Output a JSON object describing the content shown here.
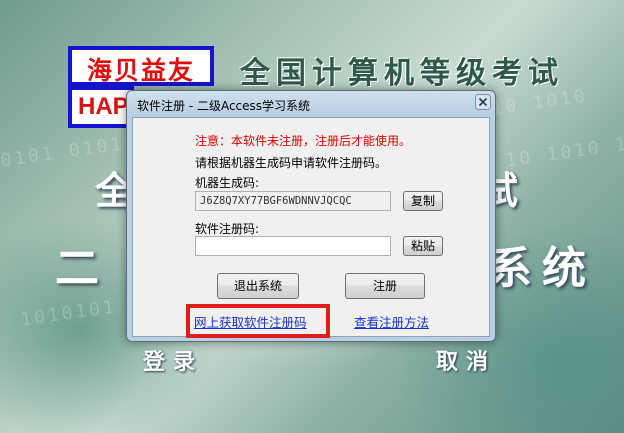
{
  "background": {
    "logo_text": "海贝益友",
    "logo_sub_text": "HAPP",
    "banner": "全国计算机等级考试",
    "big_left": "二",
    "big_left_top": "全",
    "big_right": "系统",
    "big_right_top": "试",
    "login_label": "登录",
    "cancel_label": "取消",
    "binary_rows": [
      "01010 1010",
      "10 1010 101",
      "0101 0101 0",
      "1010101 01"
    ]
  },
  "dialog": {
    "title": "软件注册 - 二级Access学习系统",
    "warning": "注意：本软件未注册，注册后才能使用。",
    "instruction": "请根据机器生成码申请软件注册码。",
    "machine_code_label": "机器生成码:",
    "machine_code_value": "J6Z8Q7XY77BGF6WDNNVJQCQC",
    "copy_button": "复制",
    "reg_code_label": "软件注册码:",
    "reg_code_value": "",
    "paste_button": "粘贴",
    "exit_button": "退出系统",
    "register_button": "注册",
    "online_link": "网上获取软件注册码",
    "howto_link": "查看注册方法"
  },
  "colors": {
    "warning": "#dd0000",
    "link": "#1a30c8",
    "highlight_box": "#e11c1c",
    "logo_border": "#1414cc"
  }
}
